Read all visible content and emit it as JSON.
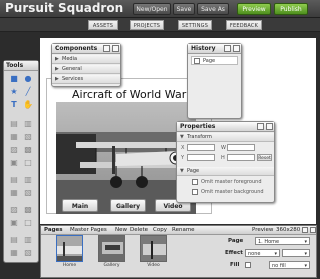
{
  "app": {
    "title": "Pursuit Squadron"
  },
  "toolbar": {
    "new_open": "New/Open",
    "save": "Save",
    "save_as": "Save As",
    "preview": "Preview",
    "publish": "Publish"
  },
  "nav": {
    "tabs": [
      "ASSETS",
      "PROJECTS",
      "SETTINGS",
      "FEEDBACK"
    ]
  },
  "tools": {
    "title": "Tools"
  },
  "canvas": {
    "page_title": "Aircraft of World War I",
    "buttons": [
      "Main",
      "Gallery",
      "Video"
    ]
  },
  "components": {
    "title": "Components",
    "items": [
      "Media",
      "General",
      "Services"
    ]
  },
  "history": {
    "title": "History",
    "items": [
      "Page"
    ]
  },
  "properties": {
    "title": "Properties",
    "transform_label": "Transform",
    "fields": {
      "x": "X",
      "y": "Y",
      "w": "W",
      "h": "H",
      "reset": "Reset"
    },
    "page_label": "Page",
    "options": [
      "Omit master foreground",
      "Omit master background"
    ]
  },
  "pages_panel": {
    "tabs": [
      "Pages",
      "Master Pages",
      "New",
      "Delete",
      "Copy",
      "Rename"
    ],
    "preview_label": "Preview",
    "preview_size": "360x280",
    "thumbs": [
      "Home",
      "Gallery",
      "Video"
    ],
    "page_label": "Page",
    "page_value": "1. Home",
    "effect_label": "Effect",
    "effect_value": "none",
    "fill_label": "Fill",
    "fill_value": "no fill"
  },
  "colors": {
    "accent_green": "#6ab333",
    "bar": "#3c3c3c",
    "icon_blue": "#3a6fc2"
  }
}
